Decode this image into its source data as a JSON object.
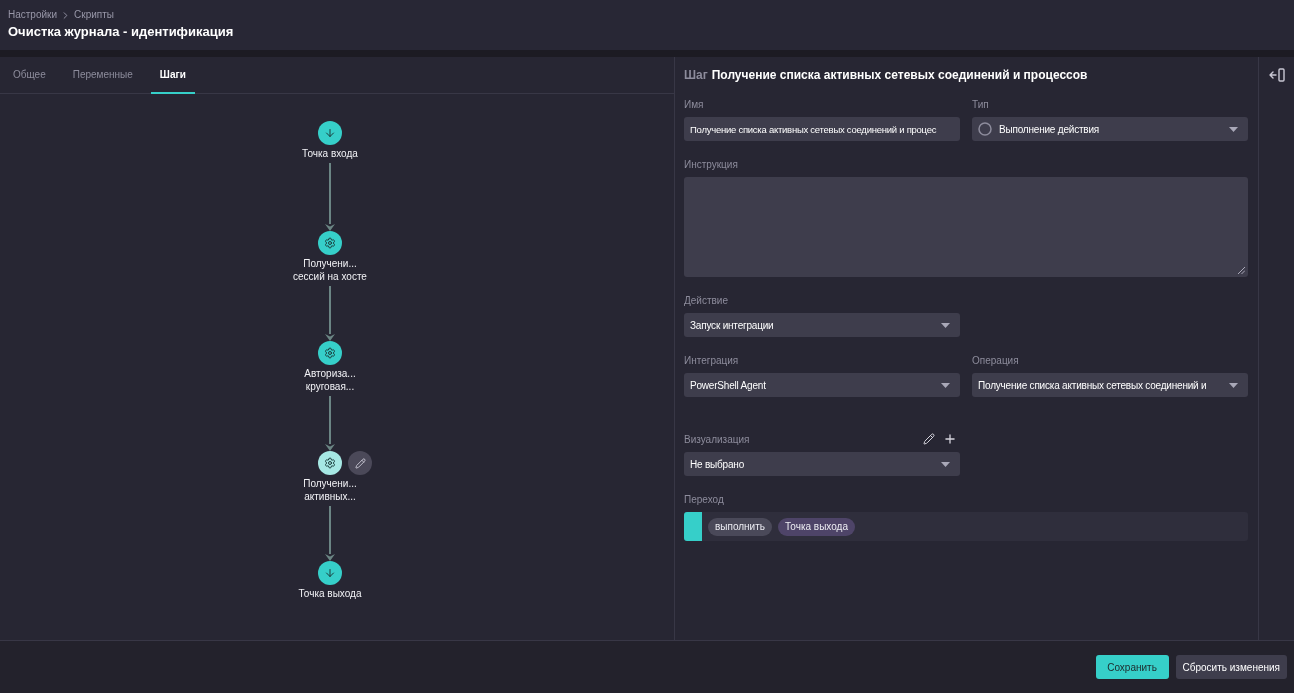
{
  "breadcrumbs": [
    {
      "label": "Настройки"
    },
    {
      "label": "Скрипты"
    }
  ],
  "title": "Очистка журнала - идентификация",
  "tabs": [
    {
      "label": "Общее",
      "selected": false
    },
    {
      "label": "Переменные",
      "selected": false
    },
    {
      "label": "Шаги",
      "selected": true
    }
  ],
  "flow": {
    "steps": [
      {
        "kind": "entry",
        "label_lines": [
          "Точка входа"
        ],
        "selected": false
      },
      {
        "kind": "action",
        "label_lines": [
          "Получени...",
          "сессий на хосте"
        ],
        "selected": false
      },
      {
        "kind": "action",
        "label_lines": [
          "Авториза...",
          "круговая..."
        ],
        "selected": false
      },
      {
        "kind": "action",
        "label_lines": [
          "Получени...",
          "активных..."
        ],
        "selected": true
      },
      {
        "kind": "exit",
        "label_lines": [
          "Точка выхода"
        ],
        "selected": false
      }
    ]
  },
  "step_panel": {
    "heading_prefix": "Шаг",
    "heading": "Получение списка активных сетевых соединений и процессов",
    "rows": [
      [
        {
          "kind": "input",
          "label": "Имя",
          "value": "Получение списка активных сетевых соединений и процес"
        },
        {
          "kind": "typeselect",
          "label": "Тип",
          "value": "Выполнение действия"
        }
      ],
      [
        {
          "kind": "textarea",
          "label": "Инструкция"
        }
      ],
      [
        {
          "kind": "select",
          "label": "Действие",
          "value": "Запуск интеграции"
        }
      ],
      [
        {
          "kind": "select",
          "label": "Интеграция",
          "value": "PowerShell Agent"
        },
        {
          "kind": "select",
          "label": "Операция",
          "value": "Получение списка активных сетевых соединений и"
        }
      ],
      [
        {
          "kind": "select",
          "label": "Визуализация",
          "value": "Не выбрано",
          "actions": [
            {
              "kind": "edit"
            },
            {
              "kind": "add"
            }
          ]
        }
      ]
    ],
    "transition": {
      "label": "Переход",
      "chips": [
        {
          "kind": "condition",
          "text": "выполнить"
        },
        {
          "kind": "target",
          "text": "Точка выхода"
        }
      ]
    }
  },
  "buttons": [
    {
      "kind": "primary",
      "label": "Сохранить"
    },
    {
      "kind": "secondary",
      "label": "Сбросить изменения"
    }
  ]
}
